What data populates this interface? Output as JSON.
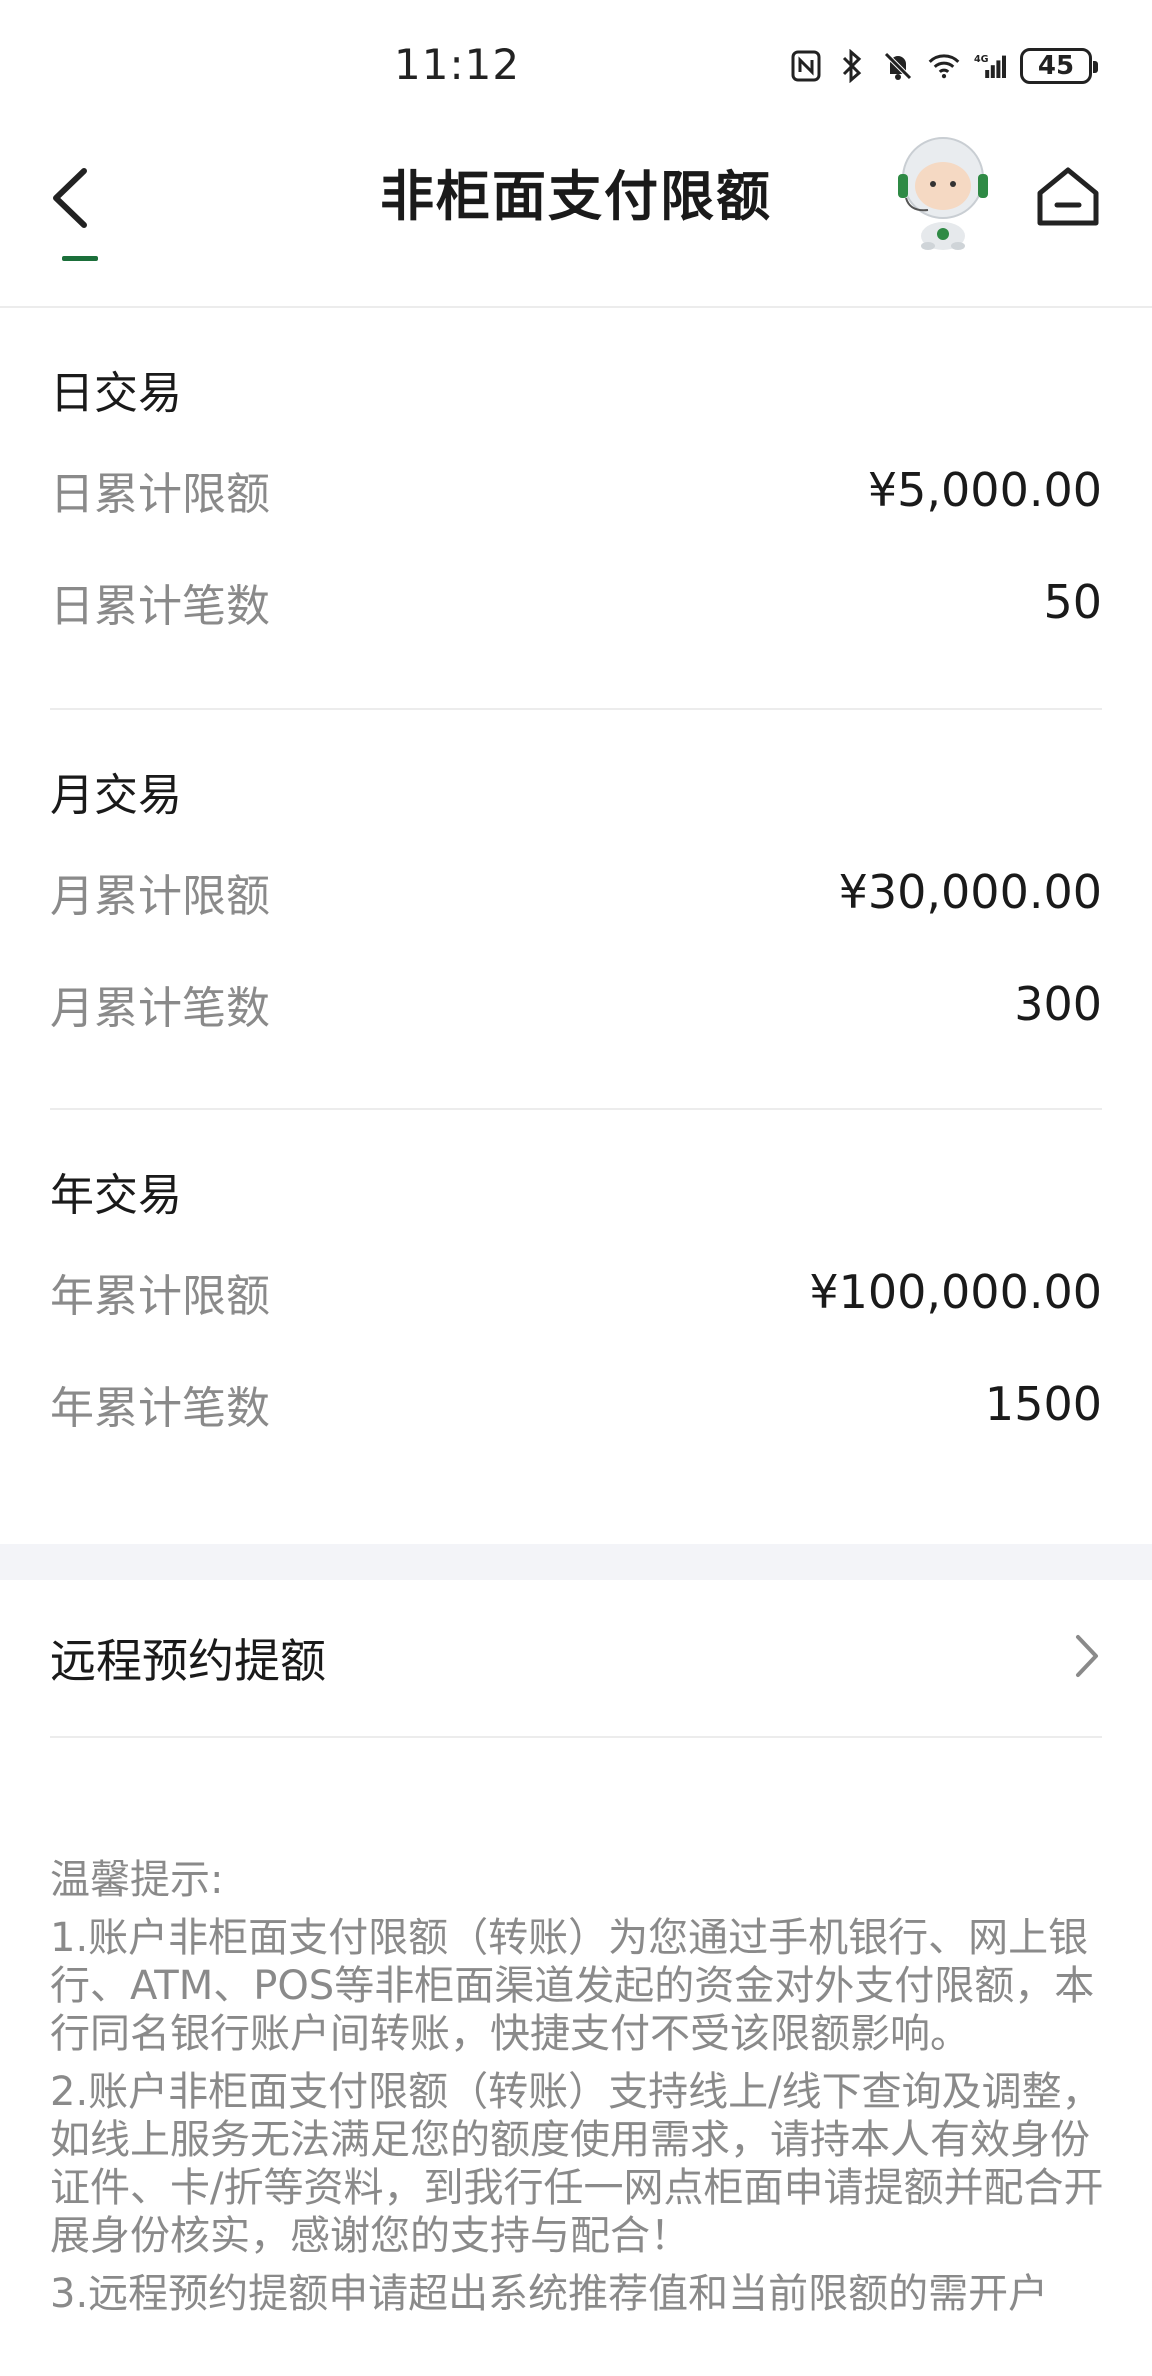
{
  "status_bar": {
    "time": "11:12",
    "battery": "45",
    "icons": [
      "nfc-icon",
      "bluetooth-icon",
      "mute-icon",
      "wifi-icon",
      "4g-signal-icon",
      "battery-icon"
    ]
  },
  "nav": {
    "title": "非柜面支付限额",
    "back_icon": "back-arrow-icon",
    "assistant_icon": "robot-assistant-icon",
    "home_icon": "home-icon"
  },
  "sections": [
    {
      "title": "日交易",
      "rows": [
        {
          "label": "日累计限额",
          "value": "¥5,000.00"
        },
        {
          "label": "日累计笔数",
          "value": "50"
        }
      ]
    },
    {
      "title": "月交易",
      "rows": [
        {
          "label": "月累计限额",
          "value": "¥30,000.00"
        },
        {
          "label": "月累计笔数",
          "value": "300"
        }
      ]
    },
    {
      "title": "年交易",
      "rows": [
        {
          "label": "年累计限额",
          "value": "¥100,000.00"
        },
        {
          "label": "年累计笔数",
          "value": "1500"
        }
      ]
    }
  ],
  "remote": {
    "label": "远程预约提额"
  },
  "tips": {
    "title": "温馨提示:",
    "items": [
      "1.账户非柜面支付限额（转账）为您通过手机银行、网上银行、ATM、POS等非柜面渠道发起的资金对外支付限额，本行同名银行账户间转账，快捷支付不受该限额影响。",
      "2.账户非柜面支付限额（转账）支持线上/线下查询及调整，如线上服务无法满足您的额度使用需求，请持本人有效身份证件、卡/折等资料，到我行任一网点柜面申请提额并配合开展身份核实，感谢您的支持与配合！",
      "3.远程预约提额申请超出系统推荐值和当前限额的需开户"
    ]
  },
  "colors": {
    "accent": "#1b6f3a",
    "label_gray": "#8a8a8a",
    "divider": "#ececec",
    "band": "#f3f4f8"
  }
}
